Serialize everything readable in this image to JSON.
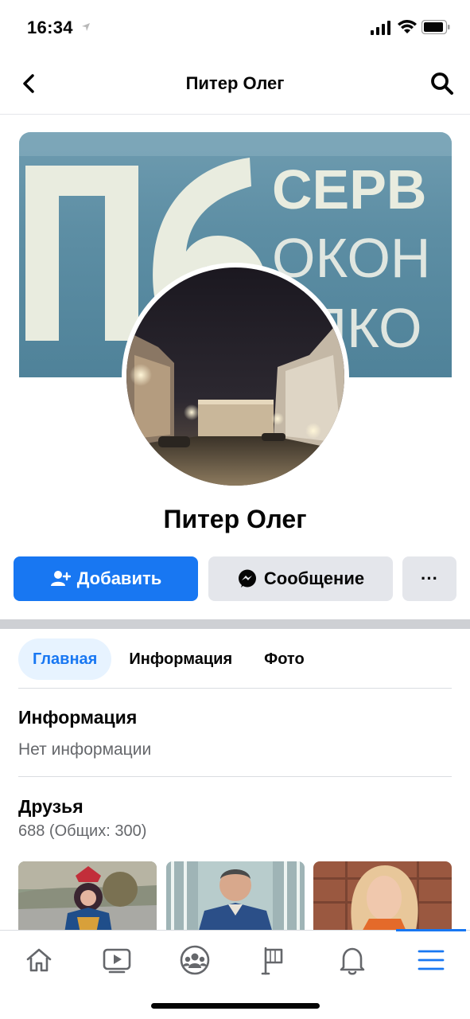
{
  "status_bar": {
    "time": "16:34"
  },
  "nav": {
    "title": "Питер Олег"
  },
  "cover": {
    "lines": [
      "СЕРВ",
      "ОКОН",
      "АЛКО"
    ]
  },
  "profile": {
    "name": "Питер Олег"
  },
  "actions": {
    "add_label": "Добавить",
    "message_label": "Сообщение",
    "more_label": "···"
  },
  "tabs": [
    {
      "label": "Главная",
      "active": true
    },
    {
      "label": "Информация",
      "active": false
    },
    {
      "label": "Фото",
      "active": false
    }
  ],
  "info": {
    "title": "Информация",
    "empty_text": "Нет информации"
  },
  "friends": {
    "title": "Друзья",
    "count_text": "688 (Общих: 300)"
  },
  "bottom_nav": [
    {
      "icon": "home-icon"
    },
    {
      "icon": "watch-icon"
    },
    {
      "icon": "groups-icon"
    },
    {
      "icon": "pages-flag-icon"
    },
    {
      "icon": "notifications-bell-icon"
    },
    {
      "icon": "menu-icon",
      "active": true
    }
  ],
  "colors": {
    "accent": "#1877f2",
    "button_gray": "#e4e6eb",
    "tab_active_bg": "#e7f3ff",
    "muted_text": "#65676b"
  }
}
